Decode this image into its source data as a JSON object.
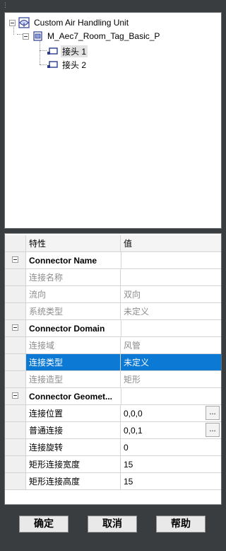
{
  "tree": {
    "root_label": "Custom Air Handling Unit",
    "family_label": "M_Aec7_Room_Tag_Basic_P",
    "connectors": [
      "接头 1",
      "接头 2"
    ]
  },
  "grid": {
    "header": {
      "name": "特性",
      "value": "值"
    },
    "categories": {
      "connector_name": "Connector Name",
      "connector_domain": "Connector Domain",
      "connector_geometry": "Connector Geomet..."
    },
    "rows": {
      "connection_name": {
        "name": "连接名称",
        "value": ""
      },
      "flow_direction": {
        "name": "流向",
        "value": "双向"
      },
      "system_type": {
        "name": "系统类型",
        "value": "未定义"
      },
      "connection_domain": {
        "name": "连接域",
        "value": "风管"
      },
      "connection_type": {
        "name": "连接类型",
        "value": "未定义"
      },
      "connection_shape": {
        "name": "连接造型",
        "value": "矩形"
      },
      "connection_position": {
        "name": "连接位置",
        "value": "0,0,0"
      },
      "normal_connection": {
        "name": "普通连接",
        "value": "0,0,1"
      },
      "connection_rotation": {
        "name": "连接旋转",
        "value": "0"
      },
      "rect_width": {
        "name": "矩形连接宽度",
        "value": "15"
      },
      "rect_height": {
        "name": "矩形连接高度",
        "value": "15"
      }
    },
    "ellipsis": "..."
  },
  "buttons": {
    "ok": "确定",
    "cancel": "取消",
    "help": "帮助"
  },
  "colors": {
    "selection": "#0c79d4",
    "background": "#3a3d40"
  }
}
